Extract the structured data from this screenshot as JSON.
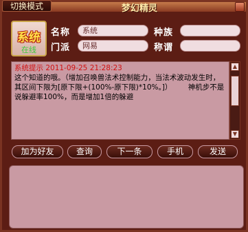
{
  "window": {
    "title": "梦幻精灵",
    "mode_button": "切换模式"
  },
  "profile": {
    "avatar_text": "系统",
    "status": "在线",
    "name_label": "名称",
    "name_value": "系统",
    "race_label": "种族",
    "race_value": "",
    "faction_label": "门派",
    "faction_value": "网易",
    "title_label": "称谓",
    "title_value": ""
  },
  "message": {
    "header": "系统提示 2011-09-25 21:28:23",
    "body": "这个知道的哦。（增加召唤兽法术控制能力，当法术波动发生时，其区间下限为[原下限+(100%-原下限)*10%。]）       神机步不是说躲避率100%，而是增加1倍的躲避"
  },
  "buttons": {
    "add_friend": "加为好友",
    "query": "查询",
    "next": "下一条",
    "phone": "手机",
    "send": "发送"
  },
  "colors": {
    "header_red": "#d01010",
    "panel_pink": "#c99aa3",
    "frame_brown": "#5c1d14"
  }
}
